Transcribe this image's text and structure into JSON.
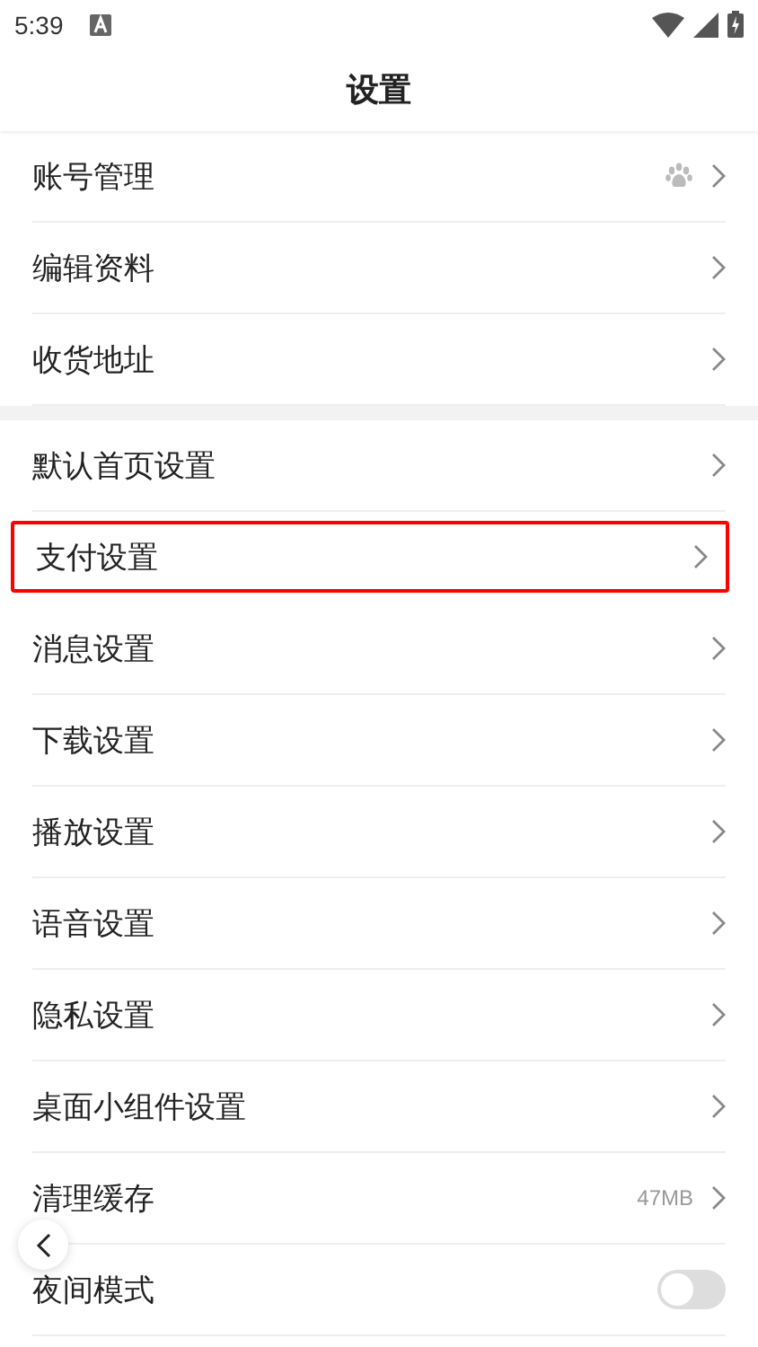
{
  "status_bar": {
    "time": "5:39"
  },
  "title": "设置",
  "groups": [
    {
      "items": [
        {
          "label": "账号管理",
          "kind": "account",
          "highlighted": false
        },
        {
          "label": "编辑资料",
          "kind": "link",
          "highlighted": false
        },
        {
          "label": "收货地址",
          "kind": "link",
          "highlighted": false
        }
      ]
    },
    {
      "items": [
        {
          "label": "默认首页设置",
          "kind": "link",
          "highlighted": false
        },
        {
          "label": "支付设置",
          "kind": "link",
          "highlighted": true
        },
        {
          "label": "消息设置",
          "kind": "link",
          "highlighted": false
        },
        {
          "label": "下载设置",
          "kind": "link",
          "highlighted": false
        },
        {
          "label": "播放设置",
          "kind": "link",
          "highlighted": false
        },
        {
          "label": "语音设置",
          "kind": "link",
          "highlighted": false
        },
        {
          "label": "隐私设置",
          "kind": "link",
          "highlighted": false
        },
        {
          "label": "桌面小组件设置",
          "kind": "link",
          "highlighted": false
        },
        {
          "label": "清理缓存",
          "kind": "link",
          "value": "47MB",
          "highlighted": false
        },
        {
          "label": "夜间模式",
          "kind": "toggle",
          "on": false,
          "highlighted": false
        }
      ]
    }
  ]
}
